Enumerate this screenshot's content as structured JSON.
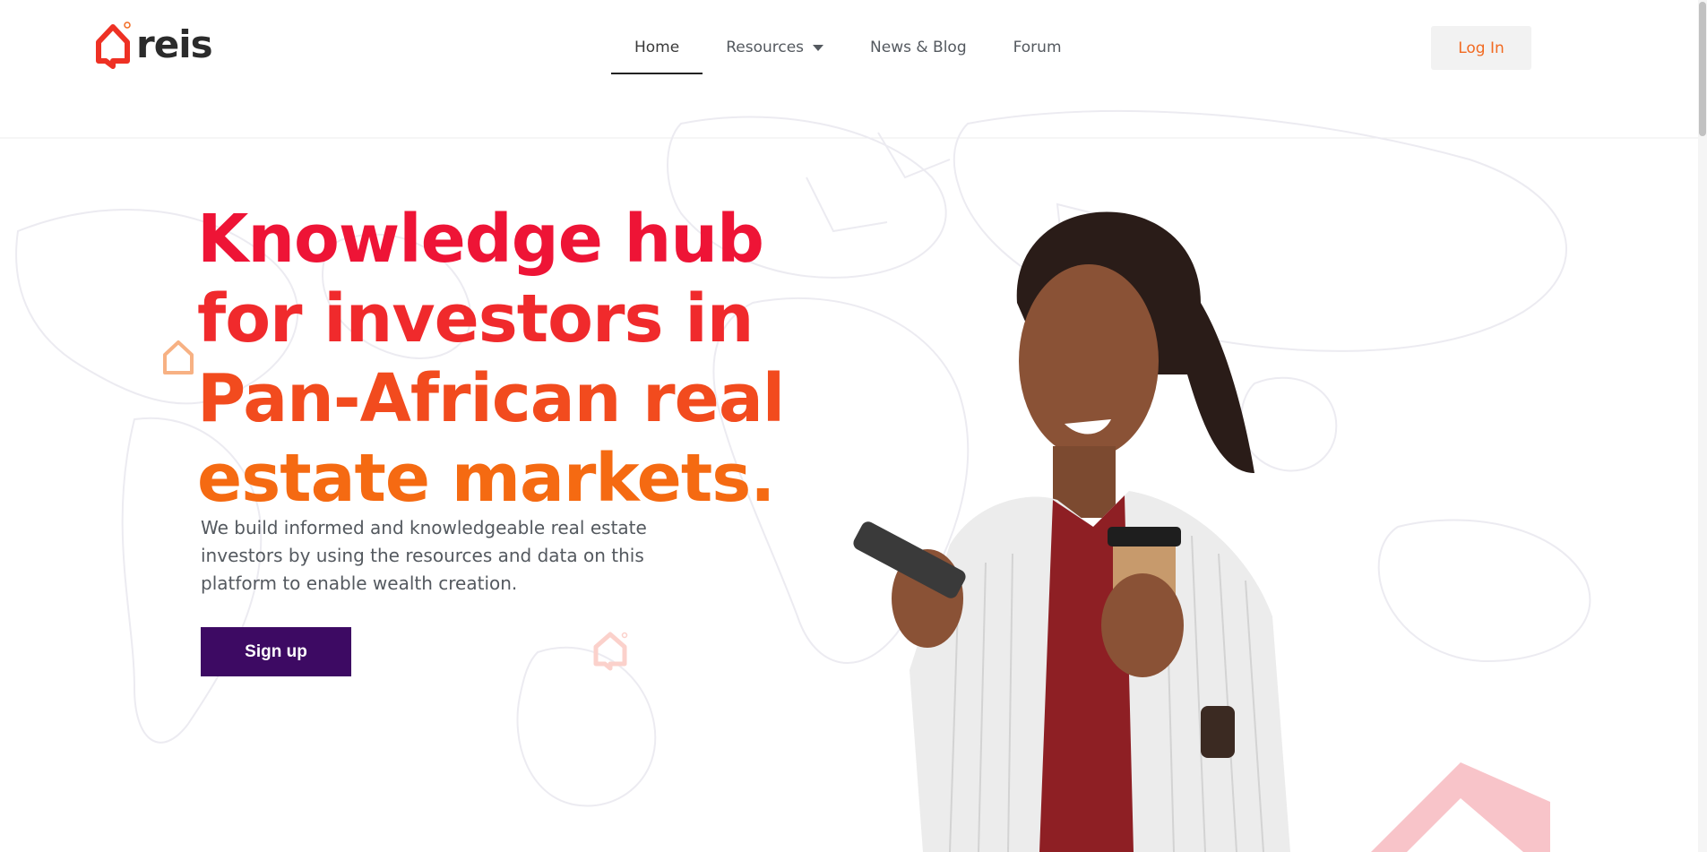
{
  "header": {
    "logo_text": "reis",
    "nav": [
      {
        "label": "Home",
        "active": true
      },
      {
        "label": "Resources",
        "has_dropdown": true
      },
      {
        "label": "News & Blog"
      },
      {
        "label": "Forum"
      }
    ],
    "login_label": "Log In"
  },
  "hero": {
    "headline_lines": [
      "Knowledge hub",
      "for investors in",
      "Pan-African real",
      "estate markets."
    ],
    "subtext": "We build informed and knowledgeable real estate investors by using the resources and data on this platform to enable wealth creation.",
    "signup_label": "Sign up",
    "image_alt": "Smiling woman holding a phone and a coffee cup"
  },
  "colors": {
    "brand_orange": "#f26a21",
    "brand_red": "#ee1436",
    "button_purple": "#3d0a63",
    "nav_text": "#54595f"
  },
  "icons": [
    "house-logo-icon",
    "chevron-down-icon",
    "house-outline-icon"
  ]
}
